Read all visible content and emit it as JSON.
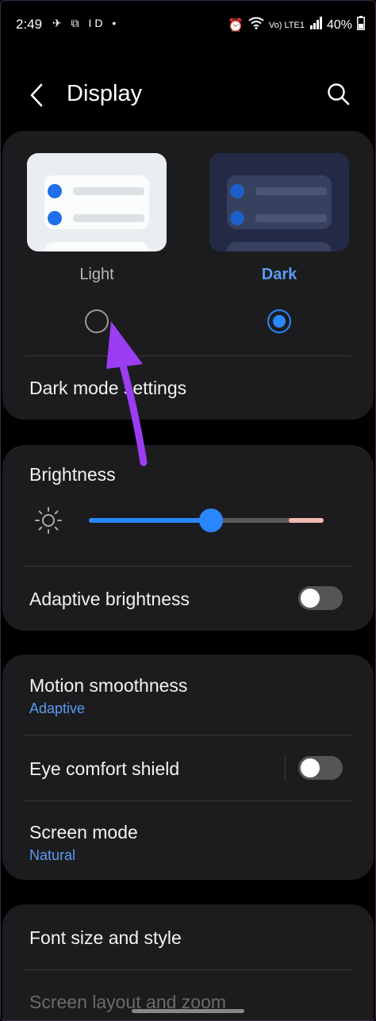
{
  "status": {
    "time": "2:49",
    "left_icons": "✈ ⧉ ID •",
    "right_small": "Vo) LTE1",
    "battery": "40%"
  },
  "header": {
    "title": "Display"
  },
  "theme": {
    "light_label": "Light",
    "dark_label": "Dark",
    "selected": "dark",
    "dark_mode_settings_label": "Dark mode settings"
  },
  "brightness": {
    "title": "Brightness",
    "level": 0.52,
    "adaptive_label": "Adaptive brightness",
    "adaptive_on": false
  },
  "motion": {
    "title": "Motion smoothness",
    "value": "Adaptive"
  },
  "eye_comfort": {
    "title": "Eye comfort shield",
    "on": false
  },
  "screen_mode": {
    "title": "Screen mode",
    "value": "Natural"
  },
  "font": {
    "title": "Font size and style",
    "next_title": "Screen layout and zoom"
  },
  "colors": {
    "accent": "#2a86ff",
    "link": "#5b9bf0",
    "card": "#1c1c1e",
    "annotation": "#9b3df2"
  }
}
